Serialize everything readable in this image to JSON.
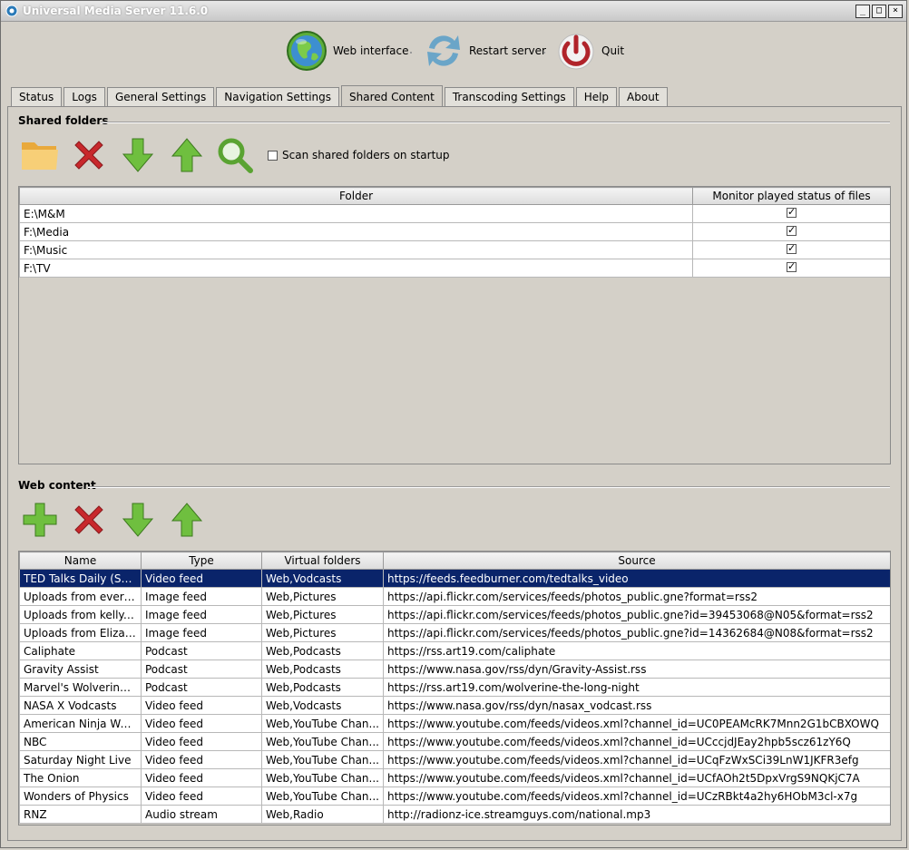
{
  "window": {
    "title": "Universal Media Server 11.6.0",
    "buttons": [
      "_",
      "□",
      "×"
    ]
  },
  "toolbar": {
    "web_interface": "Web interface",
    "restart_server": "Restart server",
    "quit": "Quit"
  },
  "tabs": [
    {
      "label": "Status"
    },
    {
      "label": "Logs"
    },
    {
      "label": "General Settings"
    },
    {
      "label": "Navigation Settings"
    },
    {
      "label": "Shared Content",
      "active": true
    },
    {
      "label": "Transcoding Settings"
    },
    {
      "label": "Help"
    },
    {
      "label": "About"
    }
  ],
  "shared": {
    "title": "Shared folders",
    "scan_label": "Scan shared folders on startup",
    "scan_checked": false,
    "headers": {
      "folder": "Folder",
      "monitor": "Monitor played status of files"
    },
    "rows": [
      {
        "folder": "E:\\M&M",
        "monitor": true
      },
      {
        "folder": "F:\\Media",
        "monitor": true
      },
      {
        "folder": "F:\\Music",
        "monitor": true
      },
      {
        "folder": "F:\\TV",
        "monitor": true
      }
    ]
  },
  "web": {
    "title": "Web content",
    "headers": {
      "name": "Name",
      "type": "Type",
      "virtual": "Virtual folders",
      "source": "Source"
    },
    "rows": [
      {
        "name": "TED Talks Daily (SD ...",
        "type": "Video feed",
        "virtual": "Web,Vodcasts",
        "source": "https://feeds.feedburner.com/tedtalks_video",
        "selected": true
      },
      {
        "name": "Uploads from everyo...",
        "type": "Image feed",
        "virtual": "Web,Pictures",
        "source": "https://api.flickr.com/services/feeds/photos_public.gne?format=rss2"
      },
      {
        "name": "Uploads from kelly....",
        "type": "Image feed",
        "virtual": "Web,Pictures",
        "source": "https://api.flickr.com/services/feeds/photos_public.gne?id=39453068@N05&format=rss2"
      },
      {
        "name": "Uploads from Elizab...",
        "type": "Image feed",
        "virtual": "Web,Pictures",
        "source": "https://api.flickr.com/services/feeds/photos_public.gne?id=14362684@N08&format=rss2"
      },
      {
        "name": "Caliphate",
        "type": "Podcast",
        "virtual": "Web,Podcasts",
        "source": "https://rss.art19.com/caliphate"
      },
      {
        "name": "Gravity Assist",
        "type": "Podcast",
        "virtual": "Web,Podcasts",
        "source": "https://www.nasa.gov/rss/dyn/Gravity-Assist.rss"
      },
      {
        "name": "Marvel's Wolverine: T...",
        "type": "Podcast",
        "virtual": "Web,Podcasts",
        "source": "https://rss.art19.com/wolverine-the-long-night"
      },
      {
        "name": "NASA X Vodcasts",
        "type": "Video feed",
        "virtual": "Web,Vodcasts",
        "source": "https://www.nasa.gov/rss/dyn/nasax_vodcast.rss"
      },
      {
        "name": "American Ninja Warr...",
        "type": "Video feed",
        "virtual": "Web,YouTube Chan...",
        "source": "https://www.youtube.com/feeds/videos.xml?channel_id=UC0PEAMcRK7Mnn2G1bCBXOWQ"
      },
      {
        "name": "NBC",
        "type": "Video feed",
        "virtual": "Web,YouTube Chan...",
        "source": "https://www.youtube.com/feeds/videos.xml?channel_id=UCccjdJEay2hpb5scz61zY6Q"
      },
      {
        "name": "Saturday Night Live",
        "type": "Video feed",
        "virtual": "Web,YouTube Chan...",
        "source": "https://www.youtube.com/feeds/videos.xml?channel_id=UCqFzWxSCi39LnW1JKFR3efg"
      },
      {
        "name": "The Onion",
        "type": "Video feed",
        "virtual": "Web,YouTube Chan...",
        "source": "https://www.youtube.com/feeds/videos.xml?channel_id=UCfAOh2t5DpxVrgS9NQKjC7A"
      },
      {
        "name": "Wonders of Physics",
        "type": "Video feed",
        "virtual": "Web,YouTube Chan...",
        "source": "https://www.youtube.com/feeds/videos.xml?channel_id=UCzRBkt4a2hy6HObM3cl-x7g"
      },
      {
        "name": "RNZ",
        "type": "Audio stream",
        "virtual": "Web,Radio",
        "source": "http://radionz-ice.streamguys.com/national.mp3"
      }
    ]
  },
  "colors": {
    "selection": "#0a246a",
    "window_bg": "#d4d0c8"
  }
}
